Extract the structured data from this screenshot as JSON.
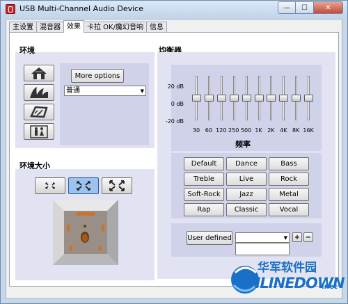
{
  "window": {
    "title": "USB Multi-Channel Audio Device"
  },
  "caption": {
    "minimize": "—",
    "maximize": "☐",
    "close": "✕"
  },
  "tabs": [
    "主设置",
    "混音器",
    "效果",
    "卡拉 OK/魔幻音响",
    "信息"
  ],
  "active_tab": "效果",
  "environment": {
    "heading": "环境",
    "buttons": [
      "house-icon",
      "opera-house-icon",
      "stone-room-icon",
      "bathroom-icon"
    ],
    "more_options": "More options",
    "preset_value": "普通"
  },
  "env_size": {
    "heading": "环境大小",
    "buttons": [
      "size-small-icon",
      "size-medium-icon",
      "size-large-icon"
    ],
    "selected": 1
  },
  "equalizer": {
    "heading": "均衡器",
    "db_labels": [
      "20 dB",
      "0 dB",
      "-20 dB"
    ],
    "bands": [
      "30",
      "60",
      "120",
      "250",
      "500",
      "1K",
      "2K",
      "4K",
      "8K",
      "16K"
    ],
    "band_levels_db": [
      0,
      0,
      0,
      0,
      0,
      0,
      0,
      0,
      0,
      0
    ],
    "axis_title": "频率",
    "presets": [
      "Default",
      "Dance",
      "Bass",
      "Treble",
      "Live",
      "Rock",
      "Soft-Rock",
      "Jazz",
      "Metal",
      "Rap",
      "Classic",
      "Vocal"
    ],
    "user_defined": "User defined",
    "plus": "+",
    "minus": "−"
  },
  "watermark": {
    "line1": "华军软件园",
    "line2": "ONLINEDOWN",
    "suffix": ".net"
  },
  "colors": {
    "title_bg": "#c9dbef",
    "panel": "#e2e3f2",
    "panel_inner": "#d0d2ea",
    "selected_btn": "#8ab4e8"
  }
}
